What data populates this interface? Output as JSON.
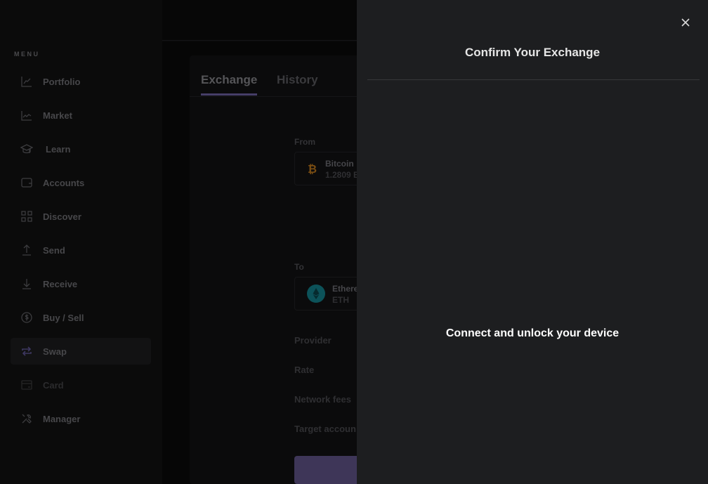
{
  "sidebar": {
    "menu_label": "MENU",
    "items": [
      {
        "label": "Portfolio",
        "icon": "chart-line-icon",
        "active": false,
        "disabled": false
      },
      {
        "label": "Market",
        "icon": "market-chart-icon",
        "active": false,
        "disabled": false
      },
      {
        "label": "Learn",
        "icon": "graduation-cap-icon",
        "active": false,
        "disabled": false
      },
      {
        "label": "Accounts",
        "icon": "wallet-icon",
        "active": false,
        "disabled": false
      },
      {
        "label": "Discover",
        "icon": "grid-icon",
        "active": false,
        "disabled": false
      },
      {
        "label": "Send",
        "icon": "arrow-up-icon",
        "active": false,
        "disabled": false
      },
      {
        "label": "Receive",
        "icon": "arrow-down-icon",
        "active": false,
        "disabled": false
      },
      {
        "label": "Buy / Sell",
        "icon": "dollar-circle-icon",
        "active": false,
        "disabled": false
      },
      {
        "label": "Swap",
        "icon": "swap-arrows-icon",
        "active": true,
        "disabled": false
      },
      {
        "label": "Card",
        "icon": "card-icon",
        "active": false,
        "disabled": true
      },
      {
        "label": "Manager",
        "icon": "tools-icon",
        "active": false,
        "disabled": false
      }
    ]
  },
  "tabs": [
    {
      "label": "Exchange",
      "active": true
    },
    {
      "label": "History",
      "active": false
    }
  ],
  "exchange": {
    "from_label": "From",
    "from_asset": {
      "name": "Bitcoin",
      "balance": "1.2809 B",
      "color": "#f7931a"
    },
    "to_label": "To",
    "to_asset": {
      "name": "Ethere",
      "ticker": "ETH",
      "color": "#0ebdcd"
    },
    "details": [
      "Provider",
      "Rate",
      "Network fees",
      "Target accoun"
    ]
  },
  "drawer": {
    "title": "Confirm Your Exchange",
    "message": "Connect and unlock your device",
    "close_icon": "close-icon"
  },
  "colors": {
    "accent": "#6353a8",
    "drawer_bg": "#1d1e20"
  }
}
